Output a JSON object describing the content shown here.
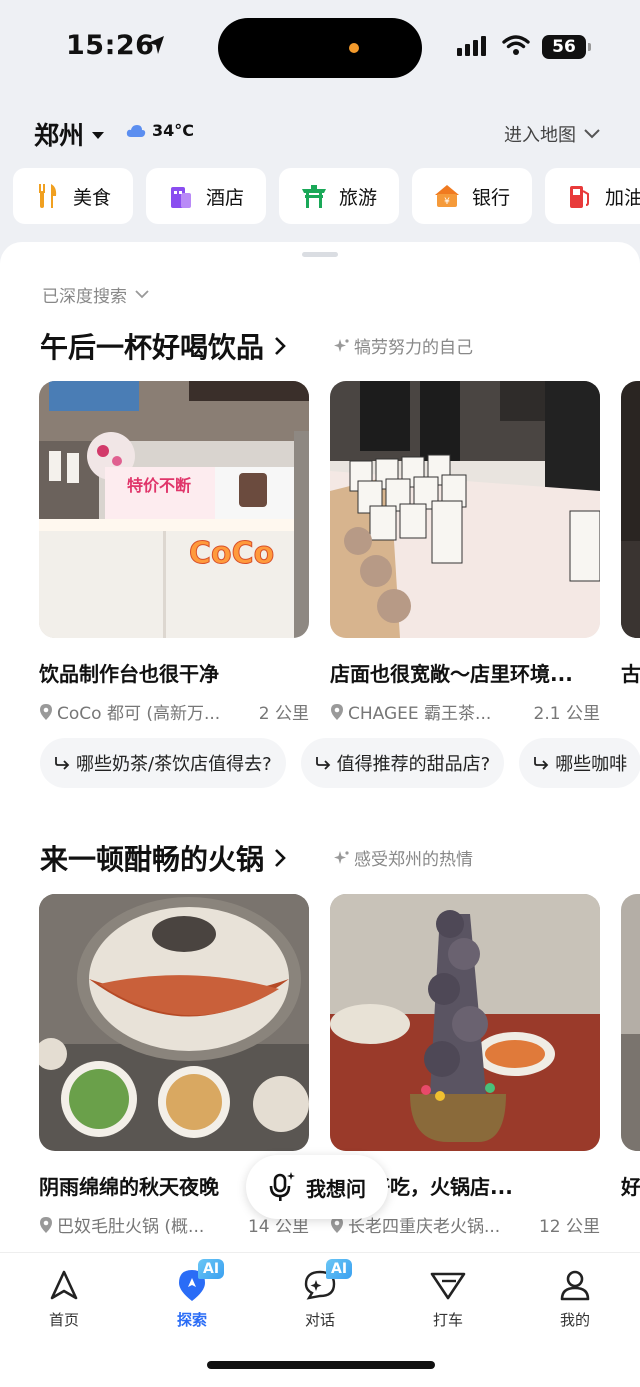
{
  "status": {
    "time": "15:26",
    "battery": "56"
  },
  "header": {
    "city": "郑州",
    "temperature": "34°C",
    "map_link": "进入地图"
  },
  "categories": [
    {
      "label": "美食",
      "icon": "fork-knife-icon"
    },
    {
      "label": "酒店",
      "icon": "hotel-icon"
    },
    {
      "label": "旅游",
      "icon": "gate-icon"
    },
    {
      "label": "银行",
      "icon": "bank-icon"
    },
    {
      "label": "加油",
      "icon": "gas-pump-icon"
    }
  ],
  "deep_search": "已深度搜索",
  "section1": {
    "title": "午后一杯好喝饮品",
    "subtitle": "犒劳努力的自己",
    "cards": [
      {
        "title": "饮品制作台也很干净",
        "shop": "CoCo 都可 (高新万...",
        "distance": "2 公里",
        "photo_text": "CoCo",
        "banner": "特价不断"
      },
      {
        "title": "店面也很宽敞～店里环境...",
        "shop": "CHAGEE 霸王茶...",
        "distance": "2.1 公里"
      },
      {
        "title": "古"
      }
    ],
    "suggestions": [
      "哪些奶茶/茶饮店值得去?",
      "值得推荐的甜品店?",
      "哪些咖啡"
    ]
  },
  "section2": {
    "title": "来一顿酣畅的火锅",
    "subtitle": "感受郑州的热情",
    "cards": [
      {
        "title": "阴雨绵绵的秋天夜晚",
        "shop": "巴奴毛肚火锅 (概...",
        "distance": "14 公里"
      },
      {
        "title": "脆又好吃，火锅店...",
        "shop": "长老四重庆老火锅...",
        "distance": "12 公里"
      },
      {
        "title": "好"
      }
    ]
  },
  "ask_button": "我想问",
  "tabs": [
    {
      "label": "首页",
      "icon": "navigation-arrow-icon"
    },
    {
      "label": "探索",
      "icon": "explore-pin-icon",
      "badge": "AI"
    },
    {
      "label": "对话",
      "icon": "chat-icon",
      "badge": "AI"
    },
    {
      "label": "打车",
      "icon": "taxi-icon"
    },
    {
      "label": "我的",
      "icon": "person-icon"
    }
  ],
  "colors": {
    "accent": "#2a6cf6",
    "background": "#eef0f4"
  }
}
